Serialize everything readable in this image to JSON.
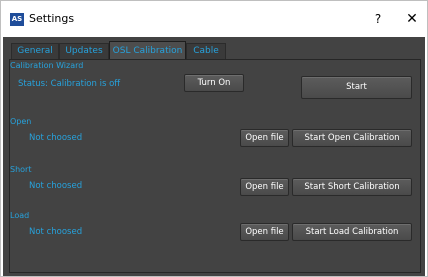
{
  "window": {
    "title": "Settings",
    "icon_text": "AS",
    "help_label": "?",
    "close_label": "✕"
  },
  "tabs": [
    {
      "label": "General",
      "active": false
    },
    {
      "label": "Updates",
      "active": false
    },
    {
      "label": "OSL Calibration",
      "active": true
    },
    {
      "label": "Cable",
      "active": false
    }
  ],
  "wizard": {
    "label": "Calibration Wizard",
    "status": "Status: Calibration is off",
    "toggle_label": "Turn On",
    "start_label": "Start"
  },
  "open": {
    "label": "Open",
    "status": "Not choosed",
    "file_label": "Open file",
    "action_label": "Start Open Calibration"
  },
  "short": {
    "label": "Short",
    "status": "Not choosed",
    "file_label": "Open file",
    "action_label": "Start Short Calibration"
  },
  "load": {
    "label": "Load",
    "status": "Not choosed",
    "file_label": "Open file",
    "action_label": "Start Load Calibration"
  },
  "colors": {
    "accent": "#27a2dc",
    "background": "#434343",
    "button_text": "#ffffff"
  }
}
